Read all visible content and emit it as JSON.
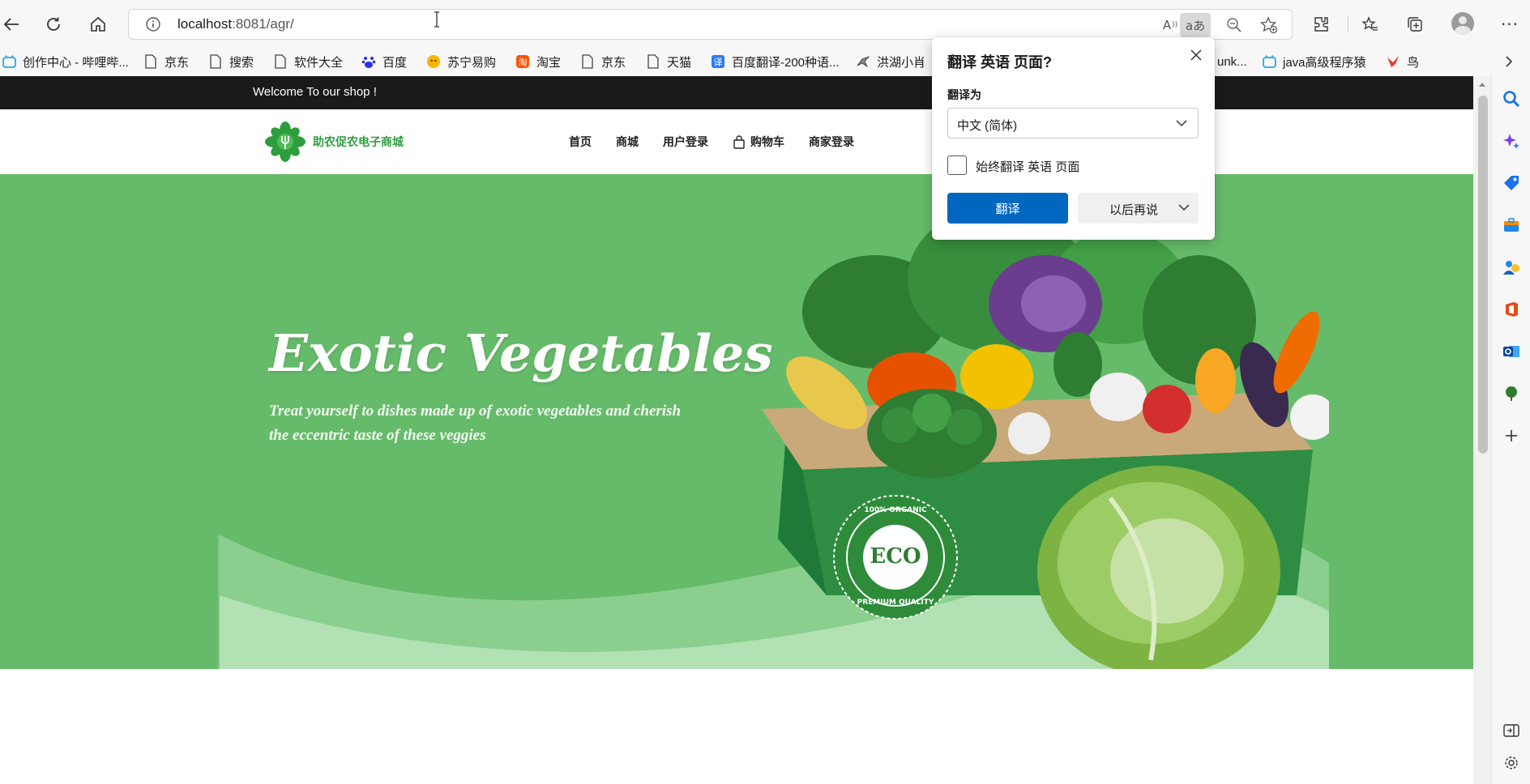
{
  "browser": {
    "url_host": "localhost",
    "url_rest": ":8081/agr/",
    "read_aloud_glyph": "A",
    "translate_glyph": "aあ"
  },
  "bookmarks": [
    {
      "label": "创作中心 - 哔哩哔...",
      "icon": "bilibili-icon"
    },
    {
      "label": "京东",
      "icon": "page-icon"
    },
    {
      "label": "搜索",
      "icon": "page-icon"
    },
    {
      "label": "软件大全",
      "icon": "page-icon"
    },
    {
      "label": "百度",
      "icon": "baidu-icon"
    },
    {
      "label": "苏宁易购",
      "icon": "suning-icon"
    },
    {
      "label": "淘宝",
      "icon": "taobao-icon"
    },
    {
      "label": "京东",
      "icon": "page-icon"
    },
    {
      "label": "天猫",
      "icon": "page-icon"
    },
    {
      "label": "百度翻译-200种语...",
      "icon": "baidu-translate-icon"
    },
    {
      "label": "洪湖小肖",
      "icon": "bird-icon"
    },
    {
      "label": "unk...",
      "icon": "page-icon"
    },
    {
      "label": "java高级程序猿",
      "icon": "bilibili-icon"
    },
    {
      "label": "鸟",
      "icon": "bird-icon"
    }
  ],
  "site": {
    "welcome": "Welcome To our shop !",
    "logo_text": "助农促农电子商城",
    "nav": [
      "首页",
      "商城",
      "用户登录",
      "购物车",
      "商家登录"
    ],
    "hero_title": "Exotic Vegetables",
    "hero_subtitle": "Treat yourself to dishes made up of exotic vegetables and cherish the eccentric taste of these veggies",
    "badge_top": "100% ORGANIC",
    "badge_center": "ECO",
    "badge_bottom": "PREMIUM QUALITY"
  },
  "translate_popup": {
    "title": "翻译 英语 页面?",
    "target_label": "翻译为",
    "target_value": "中文 (简体)",
    "always_label": "始终翻译 英语 页面",
    "always_checked": false,
    "translate_button": "翻译",
    "later_button": "以后再说"
  },
  "colors": {
    "hero_green": "#66bb6a",
    "topbar": "#1a1a1a",
    "primary_blue": "#0067c0",
    "logo_green": "#2f9e3f"
  }
}
